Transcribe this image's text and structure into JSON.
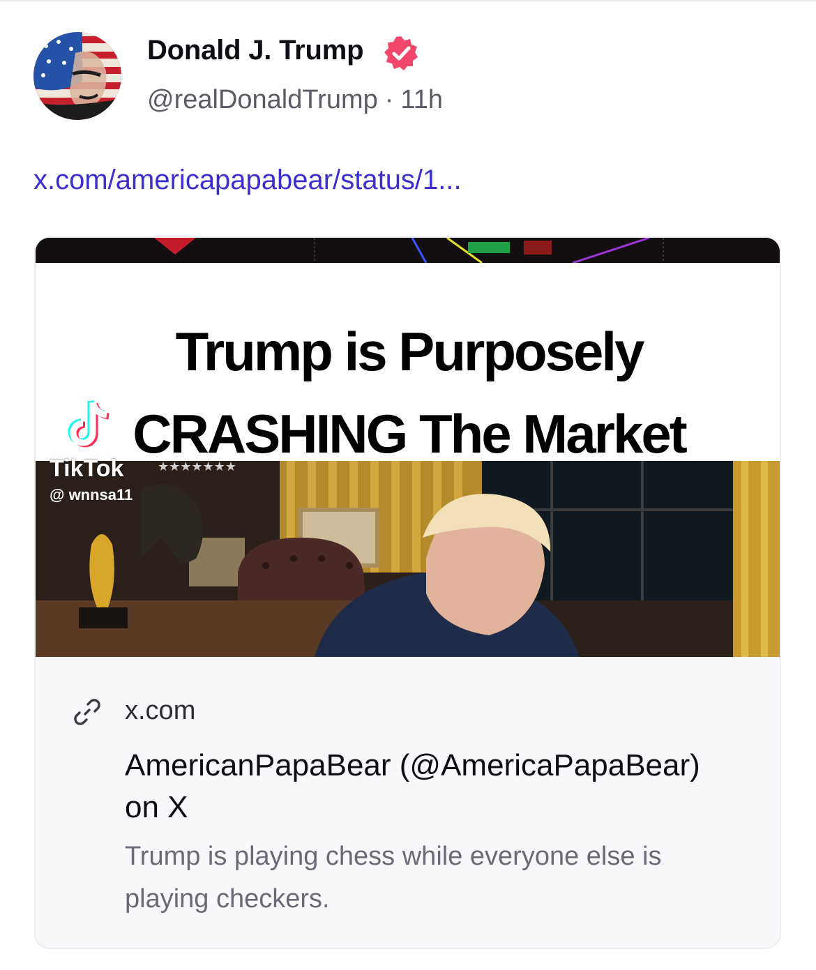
{
  "post": {
    "author_name": "Donald J. Trump",
    "handle": "@realDonaldTrump",
    "separator": "·",
    "timestamp": "11h",
    "link_text": "x.com/americapapabear/status/1..."
  },
  "card": {
    "thumbnail": {
      "headline_line1": "Trump is Purposely",
      "headline_line2": "CRASHING The Market",
      "watermark_brand": "TikTok",
      "watermark_user": "@ wnnsa11"
    },
    "domain": "x.com",
    "title": "AmericanPapaBear (@AmericaPapaBear) on X",
    "description": "Trump is playing chess while everyone else is playing checkers."
  },
  "colors": {
    "link": "#3b2fd0",
    "verified_badge": "#f0476b",
    "muted_text": "#5b5b66",
    "card_bg": "#f8f7fa"
  },
  "icons": {
    "verified": "verified-badge-icon",
    "link": "link-chain-icon",
    "tiktok": "tiktok-logo-icon"
  }
}
